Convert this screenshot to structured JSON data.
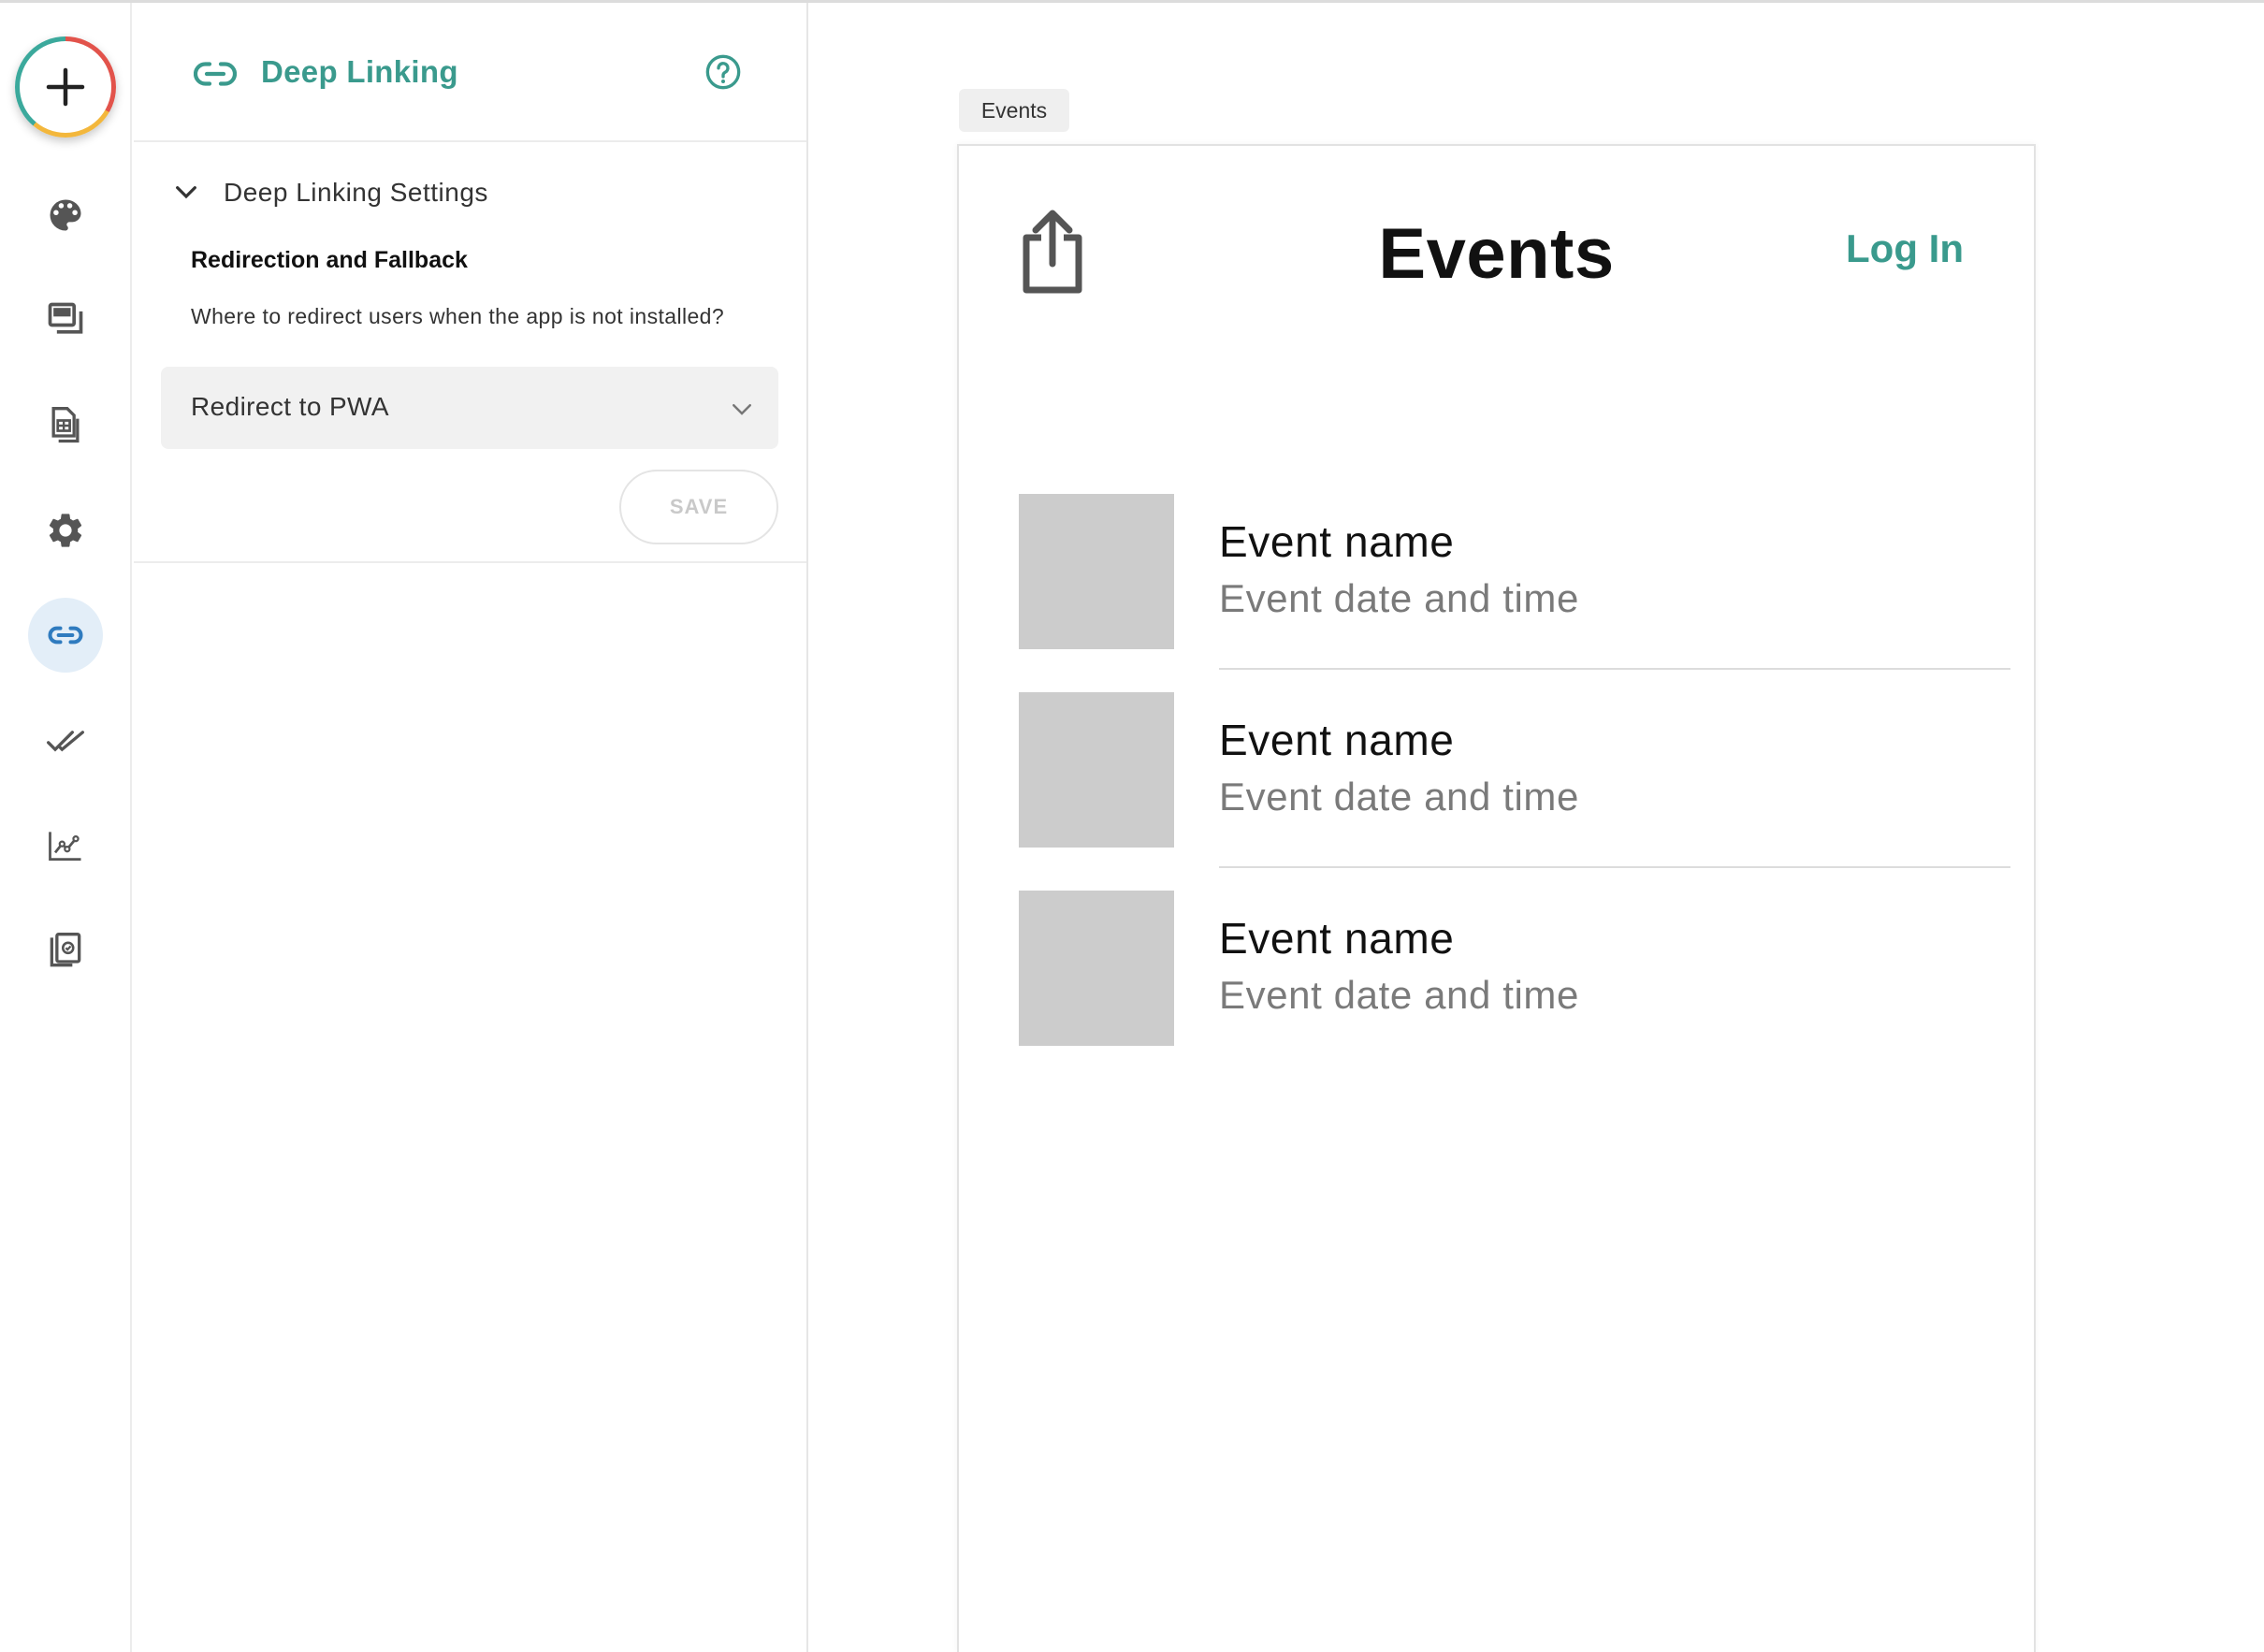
{
  "rail": {
    "items": [
      {
        "icon": "palette-icon"
      },
      {
        "icon": "screens-icon"
      },
      {
        "icon": "data-icon"
      },
      {
        "icon": "gear-icon"
      },
      {
        "icon": "link-icon",
        "active": true
      },
      {
        "icon": "double-check-icon"
      },
      {
        "icon": "analytics-icon"
      },
      {
        "icon": "publish-icon"
      }
    ],
    "active_color": "#2f7bbf",
    "icon_color": "#555555"
  },
  "panel": {
    "title": "Deep Linking",
    "section_title": "Deep Linking Settings",
    "field_label": "Redirection and Fallback",
    "field_help": "Where to redirect users when the app is not installed?",
    "select_value": "Redirect to PWA",
    "save_label": "SAVE"
  },
  "preview": {
    "screen_tag": "Events",
    "title": "Events",
    "login_label": "Log In",
    "events": [
      {
        "name": "Event name",
        "date": "Event date and time"
      },
      {
        "name": "Event name",
        "date": "Event date and time"
      },
      {
        "name": "Event name",
        "date": "Event date and time"
      }
    ]
  },
  "colors": {
    "accent": "#3a9a8d",
    "placeholder": "#cccccc"
  }
}
